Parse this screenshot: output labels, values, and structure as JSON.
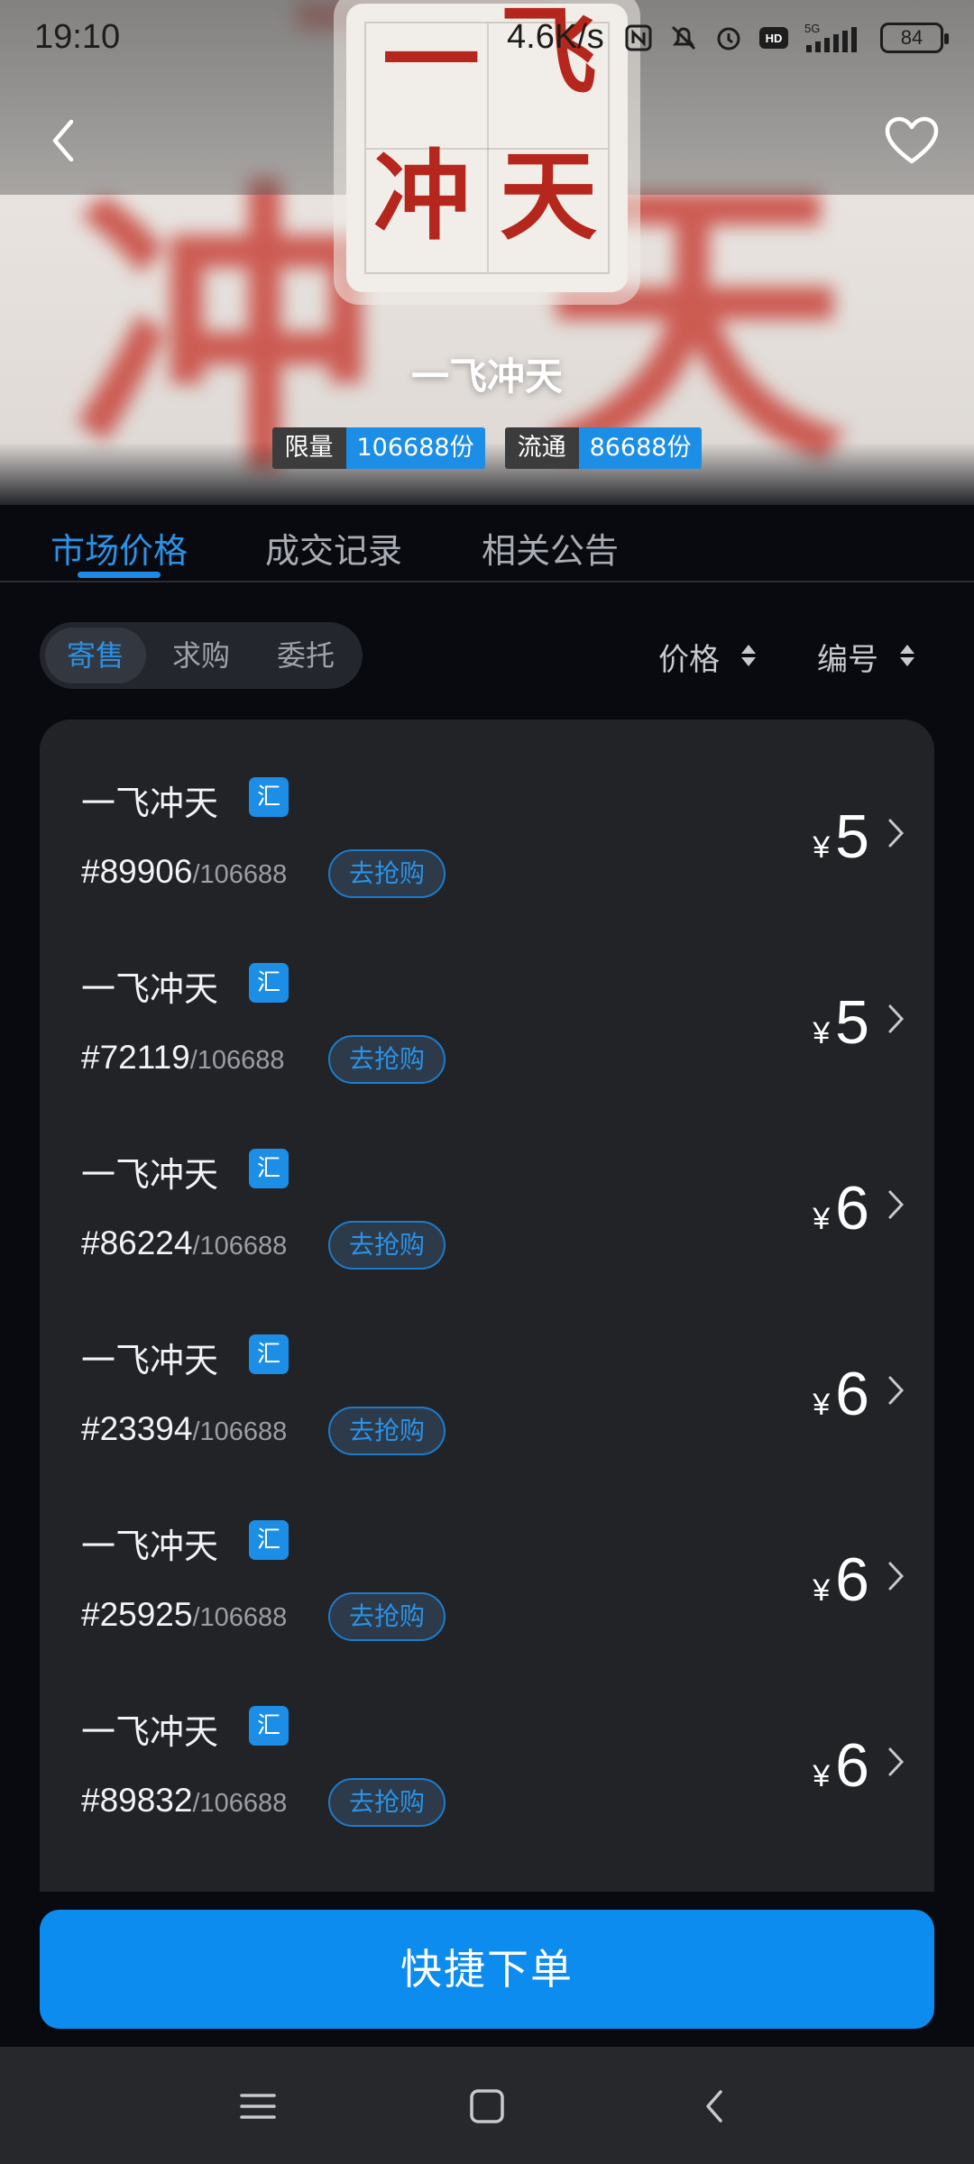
{
  "status_bar": {
    "time": "19:10",
    "speed": "4.6K/s",
    "battery": "84",
    "network": "5G"
  },
  "header": {
    "back_icon": "chevron-left-icon",
    "favorite_icon": "heart-outline-icon"
  },
  "artwork": {
    "chars": [
      "一",
      "飞",
      "冲",
      "天"
    ]
  },
  "collection": {
    "title": "一飞冲天",
    "limit_label": "限量",
    "limit_value": "106688份",
    "circulation_label": "流通",
    "circulation_value": "86688份"
  },
  "tabs": [
    {
      "label": "市场价格",
      "active": true
    },
    {
      "label": "成交记录",
      "active": false
    },
    {
      "label": "相关公告",
      "active": false
    }
  ],
  "filters": {
    "segments": [
      {
        "label": "寄售",
        "active": true
      },
      {
        "label": "求购",
        "active": false
      },
      {
        "label": "委托",
        "active": false
      }
    ],
    "sort_price": "价格",
    "sort_number": "编号"
  },
  "listings": [
    {
      "name": "一飞冲天",
      "badge": "汇",
      "serial": "#89906",
      "total": "/106688",
      "button": "去抢购",
      "currency": "¥",
      "price": "5"
    },
    {
      "name": "一飞冲天",
      "badge": "汇",
      "serial": "#72119",
      "total": "/106688",
      "button": "去抢购",
      "currency": "¥",
      "price": "5"
    },
    {
      "name": "一飞冲天",
      "badge": "汇",
      "serial": "#86224",
      "total": "/106688",
      "button": "去抢购",
      "currency": "¥",
      "price": "6"
    },
    {
      "name": "一飞冲天",
      "badge": "汇",
      "serial": "#23394",
      "total": "/106688",
      "button": "去抢购",
      "currency": "¥",
      "price": "6"
    },
    {
      "name": "一飞冲天",
      "badge": "汇",
      "serial": "#25925",
      "total": "/106688",
      "button": "去抢购",
      "currency": "¥",
      "price": "6"
    },
    {
      "name": "一飞冲天",
      "badge": "汇",
      "serial": "#89832",
      "total": "/106688",
      "button": "去抢购",
      "currency": "¥",
      "price": "6"
    }
  ],
  "quick_order_label": "快捷下单",
  "colors": {
    "accent": "#1c8ee6",
    "background": "#080a10",
    "card": "#222327"
  }
}
